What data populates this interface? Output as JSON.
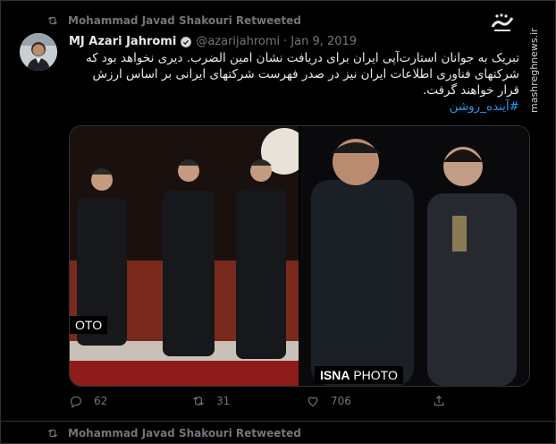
{
  "retweet": {
    "label": "Mohammad Javad Shakouri Retweeted"
  },
  "tweet": {
    "name": "MJ Azari Jahromi",
    "handle": "@azarijahromi",
    "separator": "·",
    "date": "Jan 9, 2019",
    "text": "تبریک به جوانان استارت‌آپی ایران برای دریافت نشان امین الضرب. دیری نخواهد بود که شرکتهای فناوری اطلاعات ایران نیز در صدر فهرست شرکتهای ایرانی بر اساس ارزش قرار خواهند گرفت.",
    "hashtag": "#آینده_روشن",
    "media": {
      "left_label": "OTO",
      "right_label_bold": "ISNA",
      "right_label": " PHOTO"
    },
    "actions": {
      "replies": "62",
      "retweets": "31",
      "likes": "706"
    }
  },
  "watermark": {
    "text": "mashreghnews.ir"
  },
  "next_retweet": {
    "label": "Mohammad Javad Shakouri Retweeted"
  },
  "icons": {
    "retweet": "retweet-icon",
    "verified": "verified-badge-icon",
    "reply": "reply-icon",
    "like": "heart-icon",
    "share": "share-icon"
  },
  "colors": {
    "link": "#1d9bf0",
    "muted": "#71767b",
    "background": "#000000"
  }
}
